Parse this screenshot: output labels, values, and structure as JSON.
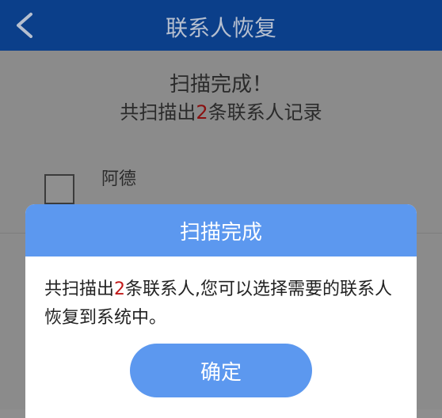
{
  "header": {
    "back_icon": "chevron-left-icon",
    "title": "联系人恢复"
  },
  "scan": {
    "title": "扫描完成！",
    "summary_prefix": "共扫描出",
    "summary_count": "2",
    "summary_suffix": "条联系人记录"
  },
  "contacts": [
    {
      "name": "阿德"
    }
  ],
  "dialog": {
    "title": "扫描完成",
    "message_prefix": "共扫描出",
    "message_count": "2",
    "message_suffix": "条联系人,您可以选择需要的联系人恢复到系统中。",
    "confirm_label": "确定"
  },
  "colors": {
    "header_bg": "#0b3f8a",
    "dialog_accent": "#5c98ef",
    "count_highlight": "#c11919"
  }
}
